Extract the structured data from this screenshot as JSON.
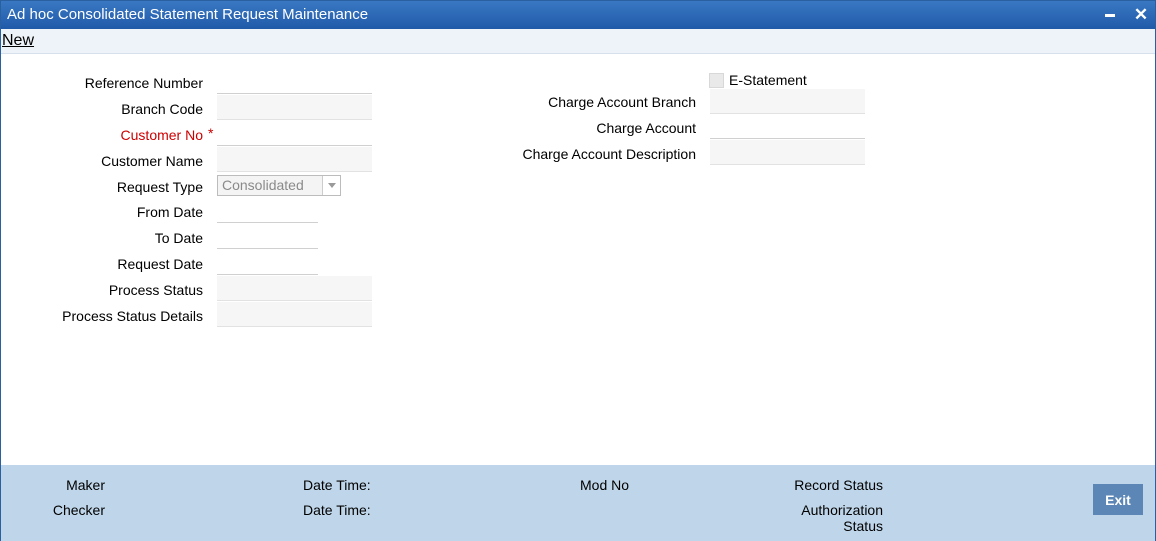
{
  "window": {
    "title": "Ad hoc Consolidated Statement Request Maintenance",
    "minimize_icon": "minimize-icon",
    "close_icon": "close-icon",
    "close_symbol": "✕"
  },
  "menu": {
    "new_label": "New"
  },
  "left_form": {
    "reference_number": {
      "label": "Reference Number",
      "value": ""
    },
    "branch_code": {
      "label": "Branch Code",
      "value": ""
    },
    "customer_no": {
      "label": "Customer No",
      "required_mark": "*",
      "value": ""
    },
    "customer_name": {
      "label": "Customer Name",
      "value": ""
    },
    "request_type": {
      "label": "Request Type",
      "value": "Consolidated"
    },
    "from_date": {
      "label": "From Date",
      "value": ""
    },
    "to_date": {
      "label": "To Date",
      "value": ""
    },
    "request_date": {
      "label": "Request Date",
      "value": ""
    },
    "process_status": {
      "label": "Process Status",
      "value": ""
    },
    "process_status_details": {
      "label": "Process Status Details",
      "value": ""
    }
  },
  "right_form": {
    "e_statement": {
      "label": "E-Statement",
      "checked": false
    },
    "charge_account_branch": {
      "label": "Charge Account Branch",
      "value": ""
    },
    "charge_account": {
      "label": "Charge Account",
      "value": ""
    },
    "charge_account_description": {
      "label": "Charge Account Description",
      "value": ""
    }
  },
  "footer": {
    "maker": "Maker",
    "checker": "Checker",
    "date_time_1": "Date Time:",
    "date_time_2": "Date Time:",
    "mod_no": "Mod No",
    "record_status": "Record Status",
    "authorization_status_line1": "Authorization",
    "authorization_status_line2": "Status",
    "exit_label": "Exit"
  },
  "colors": {
    "titlebar": "#1f5aa8",
    "required": "#cc0000",
    "footer_bg": "#bfd6ea",
    "exit_button": "#5b86b5"
  }
}
